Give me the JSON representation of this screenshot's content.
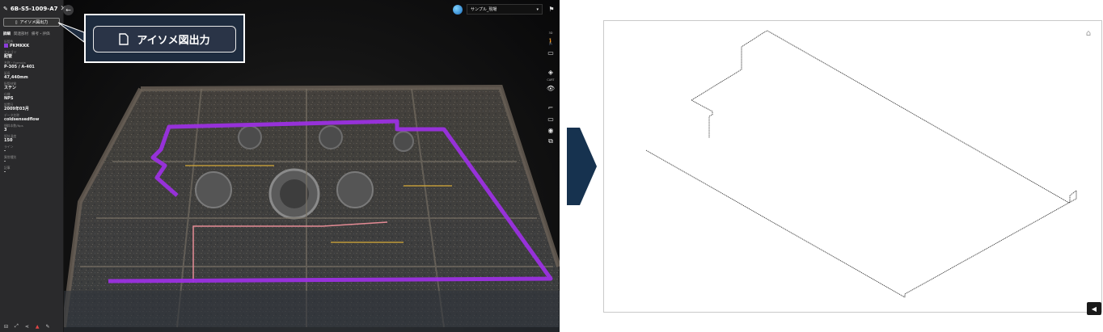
{
  "sidebar": {
    "title": "6B-S5-1009-A7",
    "export_button": "アイソメ図出力",
    "tabs": [
      "詳細",
      "関連部材",
      "備考・評価"
    ],
    "fields": [
      {
        "label": "配管色",
        "value": "PKMKKK",
        "chip": "#8b3dd8"
      },
      {
        "label": "カテゴリ",
        "value": "配管"
      },
      {
        "label": "名称・Formula",
        "value": "P-305 / A-401"
      },
      {
        "label": "延長",
        "value": "47,440mm"
      },
      {
        "label": "配管材質",
        "value": "ステン"
      },
      {
        "label": "仕様",
        "value": "NPS"
      },
      {
        "label": "設置日",
        "value": "2009年03月"
      },
      {
        "label": "データ名称",
        "value": "coldsensedflow"
      },
      {
        "label": "傾斜本数/Nps",
        "value": "3"
      },
      {
        "label": "設計温度",
        "value": "150"
      },
      {
        "label": "ライン",
        "value": "-"
      },
      {
        "label": "異常種別",
        "value": "-"
      },
      {
        "label": "記事",
        "value": "-"
      }
    ]
  },
  "callout": {
    "label": "アイソメ図出力"
  },
  "topbar": {
    "project": "サンプル_現場"
  },
  "toolbar": {
    "mode_3d": "3D",
    "label_cart": "CART"
  },
  "colors": {
    "pipe_highlight": "#9b30e0",
    "callout_bg": "#1e2c3f",
    "arrow": "#16324f"
  }
}
